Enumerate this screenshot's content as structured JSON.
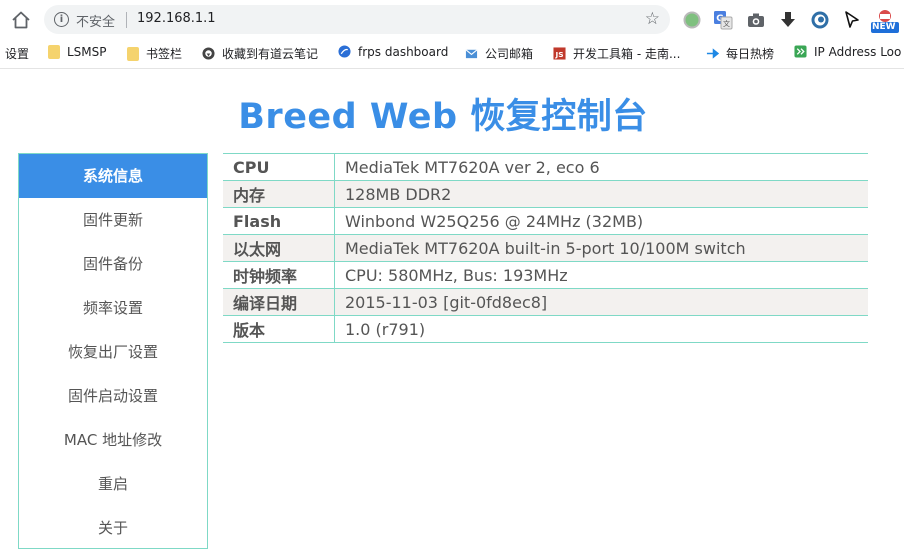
{
  "browser": {
    "security_label": "不安全",
    "url": "192.168.1.1",
    "extensions": [
      "green-circle-icon",
      "translate-icon",
      "camera-icon",
      "download-arrow-icon",
      "eye-extension-icon",
      "cursor-arrow-icon",
      "new-badge-icon"
    ],
    "new_badge": "NEW"
  },
  "bookmarks": [
    {
      "label": "设置",
      "icon": "settings-text"
    },
    {
      "label": "LSMSP",
      "icon": "folder-icon"
    },
    {
      "label": "书签栏",
      "icon": "folder-icon"
    },
    {
      "label": "收藏到有道云笔记",
      "icon": "youdao-icon"
    },
    {
      "label": "frps dashboard",
      "icon": "globe-icon"
    },
    {
      "label": "公司邮箱",
      "icon": "mail-icon"
    },
    {
      "label": "开发工具箱 - 走南...",
      "icon": "js-icon"
    },
    {
      "label": "每日热榜",
      "icon": "arrow-icon"
    },
    {
      "label": "IP Address Loo",
      "icon": "ip-icon"
    }
  ],
  "page": {
    "title": "Breed Web 恢复控制台"
  },
  "sidebar": {
    "items": [
      {
        "label": "系统信息",
        "active": true
      },
      {
        "label": "固件更新",
        "active": false
      },
      {
        "label": "固件备份",
        "active": false
      },
      {
        "label": "频率设置",
        "active": false
      },
      {
        "label": "恢复出厂设置",
        "active": false
      },
      {
        "label": "固件启动设置",
        "active": false
      },
      {
        "label": "MAC 地址修改",
        "active": false
      },
      {
        "label": "重启",
        "active": false
      },
      {
        "label": "关于",
        "active": false
      }
    ]
  },
  "system_info": {
    "rows": [
      {
        "key": "CPU",
        "value": "MediaTek MT7620A ver 2, eco 6"
      },
      {
        "key": "内存",
        "value": "128MB DDR2"
      },
      {
        "key": "Flash",
        "value": "Winbond W25Q256 @ 24MHz (32MB)"
      },
      {
        "key": "以太网",
        "value": "MediaTek MT7620A built-in 5-port 10/100M switch"
      },
      {
        "key": "时钟频率",
        "value": "CPU: 580MHz, Bus: 193MHz"
      },
      {
        "key": "编译日期",
        "value": "2015-11-03 [git-0fd8ec8]"
      },
      {
        "key": "版本",
        "value": "1.0 (r791)"
      }
    ]
  },
  "colors": {
    "accent": "#3a8ee6",
    "border": "#7fd9c6",
    "row_alt": "#f3f1ef"
  }
}
